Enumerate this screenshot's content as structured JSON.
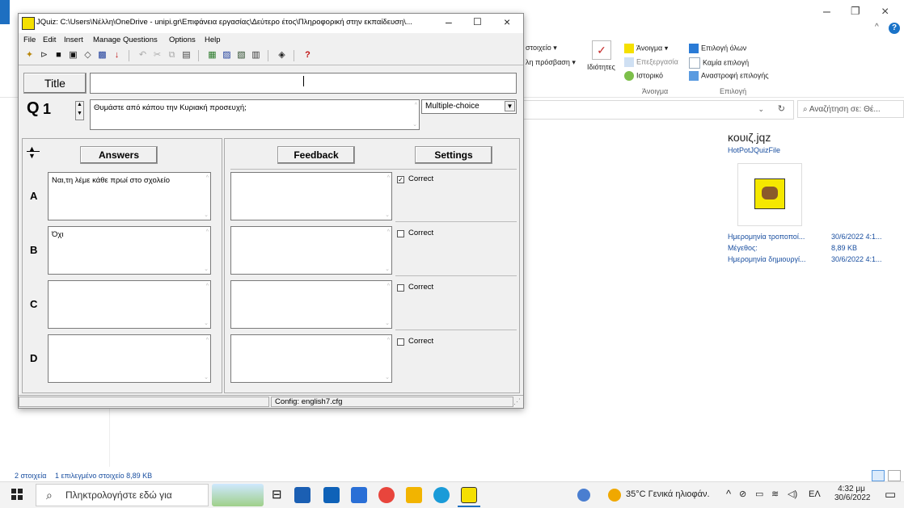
{
  "explorer": {
    "ribbon": {
      "open_group": {
        "open": "Άνοιγμα",
        "edit": "Επεξεργασία",
        "history": "Ιστορικό",
        "label": "Άνοιγμα"
      },
      "props": "Ιδιότητες",
      "select_group": {
        "select_all": "Επιλογή όλων",
        "select_none": "Καμία επιλογή",
        "invert": "Αναστροφή επιλογής",
        "label": "Επιλογή"
      },
      "new_item": "στοιχείο ▾",
      "easy_access": "λη πρόσβαση ▾"
    },
    "search_placeholder": "Αναζήτηση σε: Θέ...",
    "preview": {
      "filename": "κουιζ.jqz",
      "filetype": "HotPotJQuizFile",
      "meta": [
        {
          "key": "Ημερομηνία τροποποί...",
          "value": "30/6/2022 4:1..."
        },
        {
          "key": "Μέγεθος:",
          "value": "8,89 KB"
        },
        {
          "key": "Ημερομηνία δημιουργί...",
          "value": "30/6/2022 4:1..."
        }
      ]
    },
    "status": {
      "items": "2 στοιχεία",
      "selected": "1 επιλεγμένο στοιχείο  8,89 KB"
    }
  },
  "jquiz": {
    "title": "JQuiz: C:\\Users\\Νέλλη\\OneDrive - unipi.gr\\Επιφάνεια εργασίας\\Δεύτερο έτος\\Πληροφορική στην εκπαίδευση\\...",
    "menu": [
      "File",
      "Edit",
      "Insert",
      "Manage Questions",
      "Options",
      "Help"
    ],
    "title_button": "Title",
    "title_value": "",
    "q_label": "Q",
    "q_number": "1",
    "question_text": "Θυμάστε από κάπου την Κυριακή προσευχή;",
    "question_type": "Multiple-choice",
    "answers_label": "Answers",
    "feedback_label": "Feedback",
    "settings_label": "Settings",
    "answers": [
      {
        "letter": "A",
        "text": "Ναι,τη λέμε κάθε πρωί στο σχολείο",
        "feedback": "",
        "correct_label": "Correct",
        "correct": true
      },
      {
        "letter": "B",
        "text": "Όχι",
        "feedback": "",
        "correct_label": "Correct",
        "correct": false
      },
      {
        "letter": "C",
        "text": "",
        "feedback": "",
        "correct_label": "Correct",
        "correct": false
      },
      {
        "letter": "D",
        "text": "",
        "feedback": "",
        "correct_label": "Correct",
        "correct": false
      }
    ],
    "config": "Config: english7.cfg"
  },
  "taskbar": {
    "search_placeholder": "Πληκτρολογήστε εδώ για",
    "weather": "35°C  Γενικά ηλιοφάν.",
    "lang": "ΕΛ",
    "time": "4:32 μμ",
    "date": "30/6/2022"
  },
  "colors": {
    "accent": "#1e6fc1",
    "link": "#1a4fa0",
    "jquiz_yellow": "#f5e000"
  }
}
